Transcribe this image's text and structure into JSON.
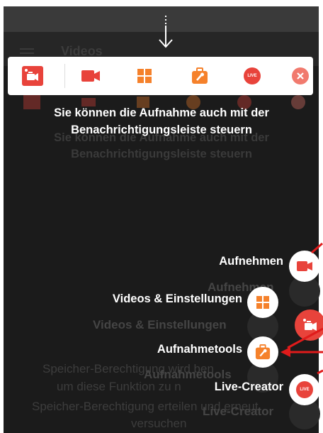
{
  "background": {
    "screen_title": "Videos",
    "storage_text": [
      "Speicher-Berechtigung wird ben",
      "um diese Funktion zu n",
      "Speicher-Berechtigung erteilen und erneut",
      "versuchen"
    ]
  },
  "toolbar": {
    "items": [
      {
        "icon": "floating-camera-icon"
      },
      {
        "icon": "video-camera-icon"
      },
      {
        "icon": "grid-icon"
      },
      {
        "icon": "toolbox-icon"
      },
      {
        "icon": "live-icon",
        "text": "LIVE"
      },
      {
        "icon": "close-icon"
      }
    ]
  },
  "hint": {
    "line1": "Sie können die Aufnahme auch mit der",
    "line2": "Benachrichtigungsleiste steuern"
  },
  "fab_menu": {
    "record_label": "Aufnehmen",
    "videos_settings_label": "Videos & Einstellungen",
    "tools_label": "Aufnahmetools",
    "live_label": "Live-Creator",
    "live_badge": "LIVE"
  },
  "colors": {
    "accent_red": "#e8433b",
    "accent_orange": "#f5812b",
    "white": "#ffffff",
    "overlay": "#1b1b1b"
  }
}
